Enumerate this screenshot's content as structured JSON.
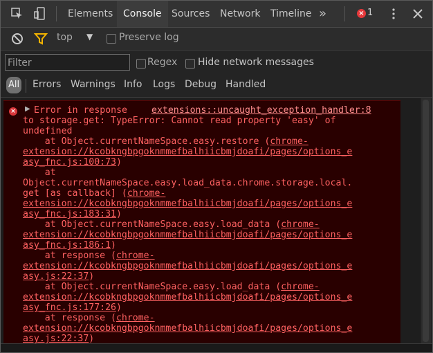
{
  "tabs": [
    "Elements",
    "Console",
    "Sources",
    "Network",
    "Timeline"
  ],
  "overflow_label": "»",
  "error_count": "1",
  "toolbar": {
    "context": "top",
    "context_arrow": "▼",
    "preserve_log": "Preserve log"
  },
  "filter": {
    "placeholder": "Filter",
    "regex_label": "Regex",
    "hide_network_label": "Hide network messages"
  },
  "levels": [
    "All",
    "Errors",
    "Warnings",
    "Info",
    "Logs",
    "Debug",
    "Handled"
  ],
  "error": {
    "source": "extensions::uncaught_exception_handler:8",
    "lines": [
      {
        "text": "Error in response ",
        "link": false,
        "x": 16
      },
      {
        "text": "to storage.get: TypeError: Cannot read property 'easy' of",
        "link": false,
        "x": 0
      },
      {
        "text": "undefined",
        "link": false,
        "x": 0
      },
      {
        "text": "    at Object.currentNameSpace.easy.restore (",
        "link": false,
        "x": 0,
        "tail": "chrome-"
      },
      {
        "text": "extension://kcobkngbpgoknmmefbalhiicbmjdoafi/pages/options_e",
        "link": true,
        "x": 0
      },
      {
        "text": "asy_fnc.js:100:73",
        "link": true,
        "x": 0,
        "tail_plain": ")"
      },
      {
        "text": "    at",
        "link": false,
        "x": 0
      },
      {
        "text": "Object.currentNameSpace.easy.load_data.chrome.storage.local.",
        "link": false,
        "x": 0
      },
      {
        "text": "get [as callback] (",
        "link": false,
        "x": 0,
        "tail": "chrome-"
      },
      {
        "text": "extension://kcobkngbpgoknmmefbalhiicbmjdoafi/pages/options_e",
        "link": true,
        "x": 0
      },
      {
        "text": "asy_fnc.js:183:31",
        "link": true,
        "x": 0,
        "tail_plain": ")"
      },
      {
        "text": "    at Object.currentNameSpace.easy.load_data (",
        "link": false,
        "x": 0,
        "tail": "chrome-"
      },
      {
        "text": "extension://kcobkngbpgoknmmefbalhiicbmjdoafi/pages/options_e",
        "link": true,
        "x": 0
      },
      {
        "text": "asy_fnc.js:186:1",
        "link": true,
        "x": 0,
        "tail_plain": ")"
      },
      {
        "text": "    at response (",
        "link": false,
        "x": 0,
        "tail": "chrome-"
      },
      {
        "text": "extension://kcobkngbpgoknmmefbalhiicbmjdoafi/pages/options_e",
        "link": true,
        "x": 0
      },
      {
        "text": "asy.js:22:37",
        "link": true,
        "x": 0,
        "tail_plain": ")"
      },
      {
        "text": "    at Object.currentNameSpace.easy.load_data (",
        "link": false,
        "x": 0,
        "tail": "chrome-"
      },
      {
        "text": "extension://kcobkngbpgoknmmefbalhiicbmjdoafi/pages/options_e",
        "link": true,
        "x": 0
      },
      {
        "text": "asy_fnc.js:177:26",
        "link": true,
        "x": 0,
        "tail_plain": ")"
      },
      {
        "text": "    at response (",
        "link": false,
        "x": 0,
        "tail": "chrome-"
      },
      {
        "text": "extension://kcobkngbpgoknmmefbalhiicbmjdoafi/pages/options_e",
        "link": true,
        "x": 0
      },
      {
        "text": "asy.js:22:37",
        "link": true,
        "x": 0,
        "tail_plain": ")"
      }
    ]
  },
  "colors": {
    "error_text": "#ff6161",
    "error_bg": "#290000",
    "accent_filter": "#f4b400"
  },
  "icons": [
    "inspect-icon",
    "device-icon",
    "clear-console-icon",
    "filter-icon",
    "more-icon",
    "close-icon",
    "error-icon",
    "expand-arrow-icon"
  ]
}
